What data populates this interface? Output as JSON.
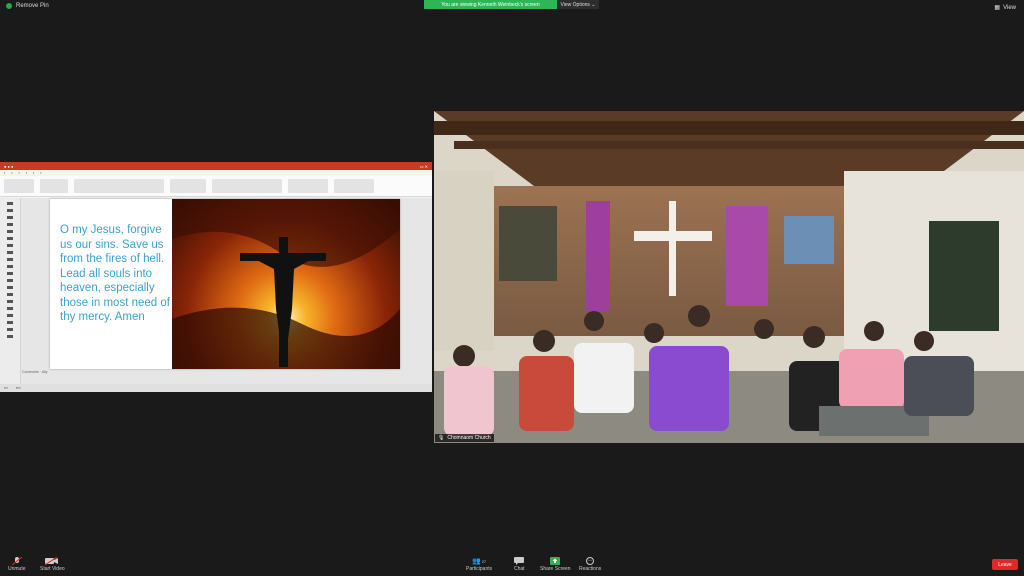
{
  "top": {
    "remove_pin": "Remove Pin",
    "viewing_banner": "You are viewing Kenneth Weinbeck's screen",
    "view_options": "View Options",
    "view": "View"
  },
  "share": {
    "slide_text": "O my Jesus, forgive us our sins. Save us from the fires of hell. Lead all souls into heaven, especially those in most need of thy mercy. Amen",
    "notes": "Comments · Ally"
  },
  "video": {
    "participant_name": "Chomnaom Church"
  },
  "toolbar": {
    "unmute": "Unmute",
    "start_video": "Start Video",
    "participants": "Participants",
    "participants_count": "27",
    "chat": "Chat",
    "share_screen": "Share Screen",
    "reactions": "Reactions",
    "leave": "Leave"
  },
  "colors": {
    "share_green": "#2fb456",
    "leave_red": "#e02828",
    "slide_text": "#3aa1d0",
    "ppt_titlebar": "#c43e1c"
  }
}
